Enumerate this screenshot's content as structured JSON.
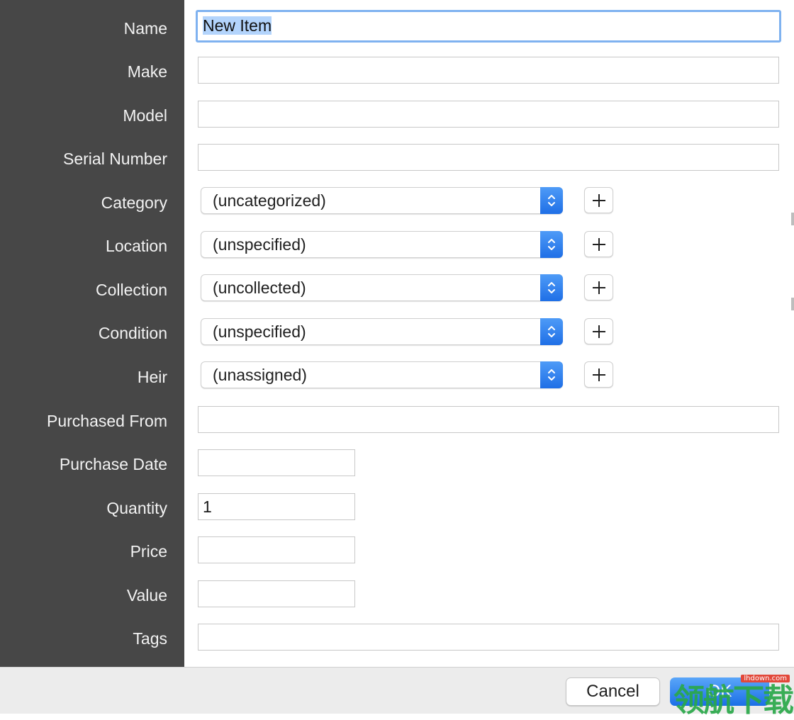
{
  "form": {
    "name": {
      "label": "Name",
      "value": "New Item"
    },
    "make": {
      "label": "Make",
      "value": ""
    },
    "model": {
      "label": "Model",
      "value": ""
    },
    "serial_number": {
      "label": "Serial Number",
      "value": ""
    },
    "category": {
      "label": "Category",
      "value": "(uncategorized)"
    },
    "location": {
      "label": "Location",
      "value": "(unspecified)"
    },
    "collection": {
      "label": "Collection",
      "value": "(uncollected)"
    },
    "condition": {
      "label": "Condition",
      "value": "(unspecified)"
    },
    "heir": {
      "label": "Heir",
      "value": "(unassigned)"
    },
    "purchased_from": {
      "label": "Purchased From",
      "value": ""
    },
    "purchase_date": {
      "label": "Purchase Date",
      "value": ""
    },
    "quantity": {
      "label": "Quantity",
      "value": "1"
    },
    "price": {
      "label": "Price",
      "value": ""
    },
    "value": {
      "label": "Value",
      "value": ""
    },
    "tags": {
      "label": "Tags",
      "value": ""
    }
  },
  "footer": {
    "cancel_label": "Cancel",
    "ok_label": "OK"
  },
  "watermark": {
    "text": "领航下载",
    "tag": "lhdown.com"
  },
  "colors": {
    "sidebar": "#474747",
    "accent": "#1f6fe6",
    "focus_ring": "#7fb2f0",
    "selection": "#b3d4fc"
  },
  "icons": {
    "stepper": "chevron-updown-icon",
    "add": "plus-icon"
  }
}
